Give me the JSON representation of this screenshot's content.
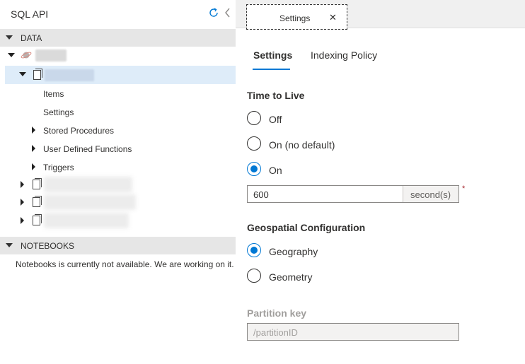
{
  "sidebar": {
    "title": "SQL API",
    "icons": {
      "refresh": "refresh-icon",
      "collapse": "chevron-left-icon"
    },
    "data_section": {
      "label": "DATA"
    },
    "tree": {
      "container_children": [
        {
          "label": "Items"
        },
        {
          "label": "Settings"
        },
        {
          "label": "Stored Procedures"
        },
        {
          "label": "User Defined Functions"
        },
        {
          "label": "Triggers"
        }
      ]
    },
    "notebooks_section": {
      "label": "NOTEBOOKS",
      "message": "Notebooks is currently not available. We are working on it."
    }
  },
  "tab": {
    "title": "Settings",
    "close": "✕"
  },
  "pivots": [
    {
      "label": "Settings",
      "active": true
    },
    {
      "label": "Indexing Policy",
      "active": false
    }
  ],
  "ttl": {
    "label": "Time to Live",
    "options": [
      {
        "label": "Off",
        "checked": false
      },
      {
        "label": "On (no default)",
        "checked": false
      },
      {
        "label": "On",
        "checked": true
      }
    ],
    "value": "600",
    "unit": "second(s)",
    "required_mark": "*"
  },
  "geo": {
    "label": "Geospatial Configuration",
    "options": [
      {
        "label": "Geography",
        "checked": true
      },
      {
        "label": "Geometry",
        "checked": false
      }
    ]
  },
  "partition": {
    "label": "Partition key",
    "value": "/partitionID"
  },
  "colors": {
    "accent": "#0078d4",
    "selected_row": "#deecf9",
    "section_header": "#e6e6e6"
  }
}
